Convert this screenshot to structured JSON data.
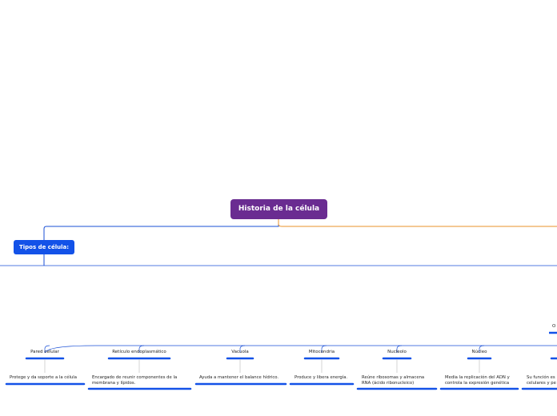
{
  "root": {
    "label": "Historia de la célula"
  },
  "main_topic": {
    "label": "Tipos de célula:"
  },
  "colors": {
    "root": "#6a2c91",
    "main": "#1352e8",
    "line_blue": "#1a4fd6",
    "line_orange": "#e8922a"
  },
  "subtopics": [
    {
      "label": "Pared celular",
      "description": [
        "Protege y da soporte a la célula"
      ]
    },
    {
      "label": "Retículo endoplasmático",
      "description": [
        "Encargado de reunir componentes de la",
        "membrana y lípidos."
      ]
    },
    {
      "label": "Vacuola",
      "description": [
        "Ayuda a mantener el balance hídrico."
      ]
    },
    {
      "label": "Mitocondria",
      "description": [
        "Produce y libera energía."
      ]
    },
    {
      "label": "Nucleolo",
      "description": [
        "Reúne ribosomas y almacena",
        "RNA (ácido ribonucleico)"
      ]
    },
    {
      "label": "Núcleo",
      "description": [
        "Media la replicación del ADN y",
        "controla la expresión genética"
      ]
    },
    {
      "label": "C",
      "description": [
        "Su función es",
        "celulares y pe"
      ]
    }
  ],
  "partial_top_right": {
    "label": "O"
  }
}
